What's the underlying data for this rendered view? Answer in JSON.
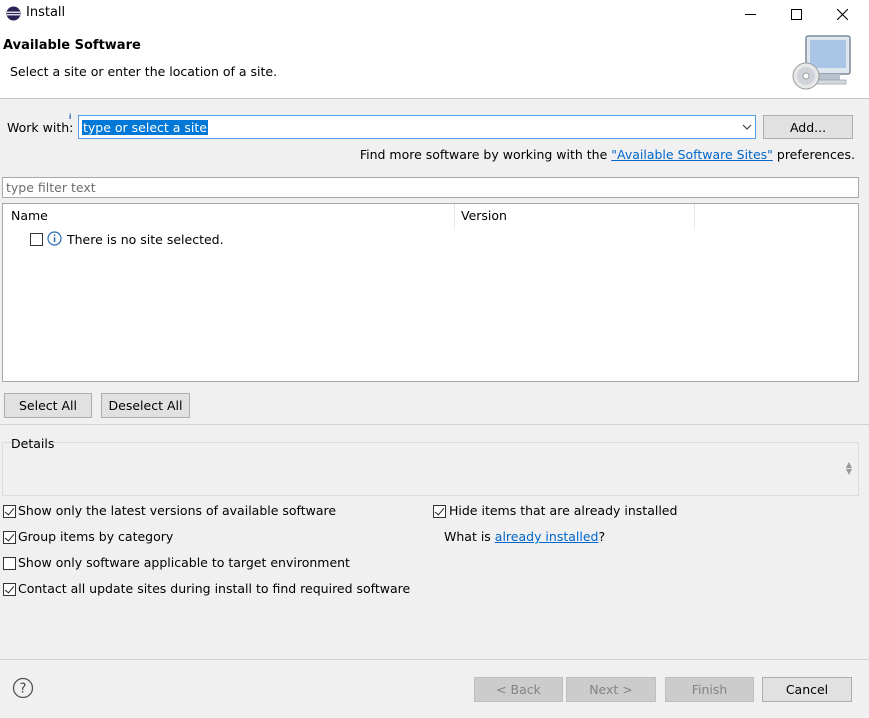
{
  "window": {
    "title": "Install"
  },
  "banner": {
    "title": "Available Software",
    "subtitle": "Select a site or enter the location of a site."
  },
  "work_with": {
    "label": "Work with:",
    "value": "type or select a site",
    "add_button": "Add..."
  },
  "find_more": {
    "prefix": "Find more software by working with the ",
    "link": "\"Available Software Sites\"",
    "suffix": " preferences."
  },
  "filter": {
    "placeholder": "type filter text"
  },
  "table": {
    "columns": [
      "Name",
      "Version"
    ],
    "rows": [
      {
        "text": "There is no site selected.",
        "checked": false
      }
    ]
  },
  "selection_buttons": {
    "select_all": "Select All",
    "deselect_all": "Deselect All"
  },
  "details": {
    "label": "Details"
  },
  "options": {
    "latest_versions": {
      "label": "Show only the latest versions of available software",
      "checked": true
    },
    "group_by_category": {
      "label": "Group items by category",
      "checked": true
    },
    "target_env": {
      "label": "Show only software applicable to target environment",
      "checked": false
    },
    "contact_sites": {
      "label": "Contact all update sites during install to find required software",
      "checked": true
    },
    "hide_installed": {
      "label": "Hide items that are already installed",
      "checked": true
    },
    "what_is": {
      "prefix": "What is ",
      "link": "already installed",
      "suffix": "?"
    }
  },
  "footer": {
    "back": "< Back",
    "next": "Next >",
    "finish": "Finish",
    "cancel": "Cancel"
  },
  "colors": {
    "link": "#0066cc",
    "selection": "#0078d7",
    "focus_border": "#569de5"
  }
}
